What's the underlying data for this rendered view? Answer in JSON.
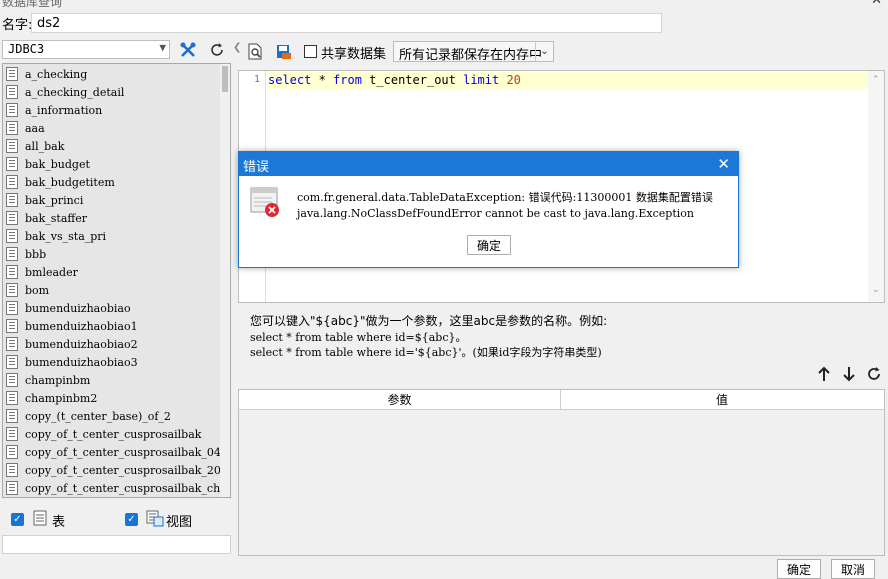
{
  "window": {
    "title": "数据库查询",
    "close_icon": "close-icon"
  },
  "name_field": {
    "label": "名字:",
    "value": "ds2"
  },
  "connection": {
    "selected": "JDBC3"
  },
  "tables": [
    "a_checking",
    "a_checking_detail",
    "a_information",
    "aaa",
    "all_bak",
    "bak_budget",
    "bak_budgetitem",
    "bak_princi",
    "bak_staffer",
    "bak_vs_sta_pri",
    "bbb",
    "bmleader",
    "bom",
    "bumenduizhaobiao",
    "bumenduizhaobiao1",
    "bumenduizhaobiao2",
    "bumenduizhaobiao3",
    "champinbm",
    "champinbm2",
    "copy_(t_center_base)_of_2",
    "copy_of_t_center_cusprosailbak",
    "copy_of_t_center_cusprosailbak_04",
    "copy_of_t_center_cusprosailbak_20",
    "copy_of_t_center_cusprosailbak_ch"
  ],
  "filters": {
    "table_label": "表",
    "view_label": "视图",
    "table_checked": true,
    "view_checked": true
  },
  "toolbar": {
    "shared_label": "共享数据集",
    "shared_checked": false,
    "mode_value": "所有记录都保存在内存中"
  },
  "editor": {
    "line_number": "1",
    "sql": "select * from t_center_out limit 20"
  },
  "hint": {
    "line1": "您可以键入\"${abc}\"做为一个参数，这里abc是参数的名称。例如:",
    "line2": "select * from table where id=${abc}。",
    "line3": "select * from table where id='${abc}'。(如果id字段为字符串类型)"
  },
  "params": {
    "col_param": "参数",
    "col_value": "值"
  },
  "buttons": {
    "ok": "确定",
    "cancel": "取消"
  },
  "error_dialog": {
    "title": "错误",
    "line1": "com.fr.general.data.TableDataException: 错误代码:11300001 数据集配置错误",
    "line2": "java.lang.NoClassDefFoundError cannot be cast to java.lang.Exception",
    "ok": "确定"
  }
}
